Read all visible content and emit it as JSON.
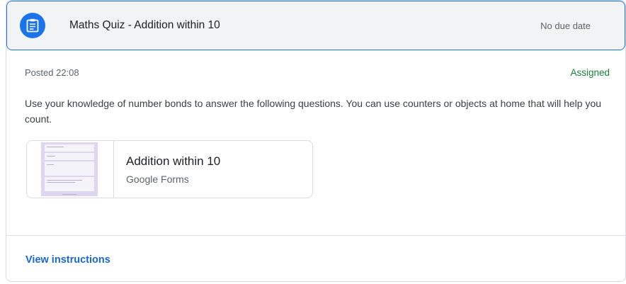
{
  "assignment": {
    "title": "Maths Quiz - Addition within 10",
    "due": "No due date",
    "icon": "assignment-icon",
    "posted": "Posted 22:08",
    "status": "Assigned",
    "description": "Use your knowledge of number bonds to answer the following questions. You can use counters or objects at home that will help you count."
  },
  "attachment": {
    "title": "Addition within 10",
    "type": "Google Forms",
    "thumbnail_icon": "form-thumbnail"
  },
  "footer": {
    "view_instructions": "View instructions"
  },
  "colors": {
    "accent": "#1a73e8",
    "status_green": "#188038",
    "link_blue": "#1967d2"
  }
}
